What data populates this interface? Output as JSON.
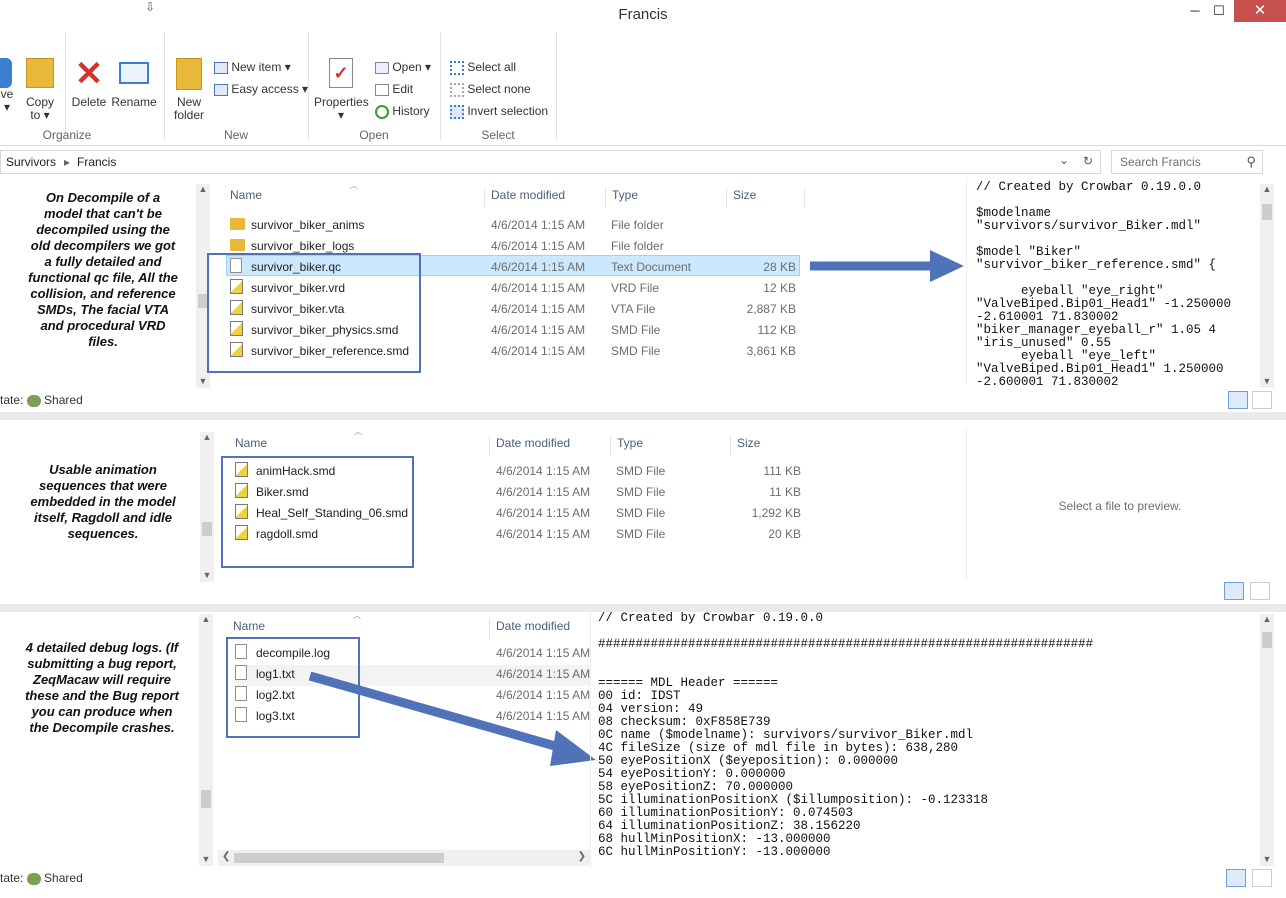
{
  "window": {
    "title": "Francis",
    "min": "─",
    "max": "☐",
    "close": "✕"
  },
  "ribbon": {
    "move_label": "ve",
    "move_sub": "▾",
    "copy_label": "Copy",
    "copy_sub": "to ▾",
    "delete_label": "Delete",
    "rename_label": "Rename",
    "organize_group": "Organize",
    "new_folder_label1": "New",
    "new_folder_label2": "folder",
    "new_item": "New item ▾",
    "easy_access": "Easy access ▾",
    "new_group": "New",
    "properties_label": "Properties",
    "properties_sub": "▾",
    "open": "Open ▾",
    "edit": "Edit",
    "history": "History",
    "open_group": "Open",
    "select_all": "Select all",
    "select_none": "Select none",
    "invert_selection": "Invert selection",
    "select_group": "Select"
  },
  "address": {
    "crumb1": "Survivors",
    "sep": "▸",
    "crumb2": "Francis",
    "dropdown": "⌄",
    "refresh": "↻"
  },
  "search": {
    "placeholder": "Search Francis",
    "icon": "search-icon"
  },
  "pane1": {
    "note": "On Decompile of a model that can't be decompiled using the old decompilers we got a fully detailed and functional qc file, All the collision, and reference SMDs, The facial VTA and procedural VRD files.",
    "cols": {
      "name": "Name",
      "date": "Date modified",
      "type": "Type",
      "size": "Size"
    },
    "rows": [
      {
        "name": "survivor_biker_anims",
        "date": "4/6/2014 1:15 AM",
        "type": "File folder",
        "size": ""
      },
      {
        "name": "survivor_biker_logs",
        "date": "4/6/2014 1:15 AM",
        "type": "File folder",
        "size": ""
      },
      {
        "name": "survivor_biker.qc",
        "date": "4/6/2014 1:15 AM",
        "type": "Text Document",
        "size": "28 KB"
      },
      {
        "name": "survivor_biker.vrd",
        "date": "4/6/2014 1:15 AM",
        "type": "VRD File",
        "size": "12 KB"
      },
      {
        "name": "survivor_biker.vta",
        "date": "4/6/2014 1:15 AM",
        "type": "VTA File",
        "size": "2,887 KB"
      },
      {
        "name": "survivor_biker_physics.smd",
        "date": "4/6/2014 1:15 AM",
        "type": "SMD File",
        "size": "112 KB"
      },
      {
        "name": "survivor_biker_reference.smd",
        "date": "4/6/2014 1:15 AM",
        "type": "SMD File",
        "size": "3,861 KB"
      }
    ],
    "preview": "// Created by Crowbar 0.19.0.0\n\n$modelname\n\"survivors/survivor_Biker.mdl\"\n\n$model \"Biker\"\n\"survivor_biker_reference.smd\" {\n\n      eyeball \"eye_right\"\n\"ValveBiped.Bip01_Head1\" -1.250000\n-2.610001 71.830002\n\"biker_manager_eyeball_r\" 1.05 4\n\"iris_unused\" 0.55\n      eyeball \"eye_left\"\n\"ValveBiped.Bip01_Head1\" 1.250000\n-2.600001 71.830002",
    "status_label": "tate:",
    "status_value": "Shared"
  },
  "pane2": {
    "note": "Usable animation sequences that were embedded in the model itself, Ragdoll and idle sequences.",
    "cols": {
      "name": "Name",
      "date": "Date modified",
      "type": "Type",
      "size": "Size"
    },
    "rows": [
      {
        "name": "animHack.smd",
        "date": "4/6/2014 1:15 AM",
        "type": "SMD File",
        "size": "111 KB"
      },
      {
        "name": "Biker.smd",
        "date": "4/6/2014 1:15 AM",
        "type": "SMD File",
        "size": "11 KB"
      },
      {
        "name": "Heal_Self_Standing_06.smd",
        "date": "4/6/2014 1:15 AM",
        "type": "SMD File",
        "size": "1,292 KB"
      },
      {
        "name": "ragdoll.smd",
        "date": "4/6/2014 1:15 AM",
        "type": "SMD File",
        "size": "20 KB"
      }
    ],
    "preview": "Select a file to preview."
  },
  "pane3": {
    "note": "4 detailed debug logs. (If submitting a bug report, ZeqMacaw will require these and the Bug report you can produce when the Decompile crashes.",
    "cols": {
      "name": "Name",
      "date": "Date modified"
    },
    "rows": [
      {
        "name": "decompile.log",
        "date": "4/6/2014 1:15 AM"
      },
      {
        "name": "log1.txt",
        "date": "4/6/2014 1:15 AM"
      },
      {
        "name": "log2.txt",
        "date": "4/6/2014 1:15 AM"
      },
      {
        "name": "log3.txt",
        "date": "4/6/2014 1:15 AM"
      }
    ],
    "preview": "// Created by Crowbar 0.19.0.0\n\n##################################################################\n\n\n====== MDL Header ======\n00 id: IDST\n04 version: 49\n08 checksum: 0xF858E739\n0C name ($modelname): survivors/survivor_Biker.mdl\n4C fileSize (size of mdl file in bytes): 638,280\n50 eyePositionX ($eyeposition): 0.000000\n54 eyePositionY: 0.000000\n58 eyePositionZ: 70.000000\n5C illuminationPositionX ($illumposition): -0.123318\n60 illuminationPositionY: 0.074503\n64 illuminationPositionZ: 38.156220\n68 hullMinPositionX: -13.000000\n6C hullMinPositionY: -13.000000",
    "status_label": "tate:",
    "status_value": "Shared"
  },
  "colors": {
    "accent": "#4f72b8",
    "close": "#c7504c",
    "selection": "#cce8ff"
  }
}
